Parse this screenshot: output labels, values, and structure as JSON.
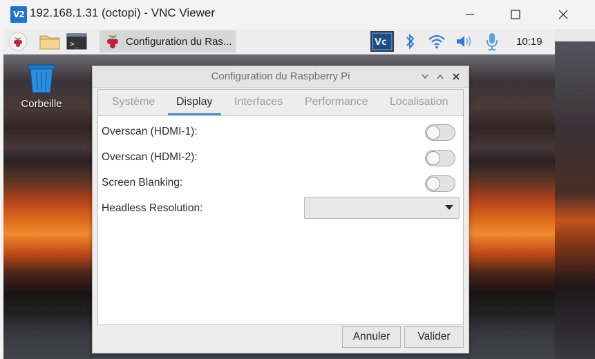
{
  "viewer": {
    "title": "192.168.1.31 (octopi) - VNC Viewer",
    "logo_text": "V2"
  },
  "taskbar": {
    "task_label": "Configuration du Ras...",
    "clock": "10:19"
  },
  "desktop": {
    "trash_label": "Corbeille"
  },
  "dialog": {
    "title": "Configuration du Raspberry Pi",
    "tabs": [
      {
        "label": "Système",
        "active": false
      },
      {
        "label": "Display",
        "active": true
      },
      {
        "label": "Interfaces",
        "active": false
      },
      {
        "label": "Performance",
        "active": false
      },
      {
        "label": "Localisation",
        "active": false
      }
    ],
    "settings": {
      "overscan_hdmi1": {
        "label": "Overscan (HDMI-1):",
        "enabled": false
      },
      "overscan_hdmi2": {
        "label": "Overscan (HDMI-2):",
        "enabled": false
      },
      "screen_blanking": {
        "label": "Screen Blanking:",
        "enabled": false
      },
      "headless_resolution": {
        "label": "Headless Resolution:",
        "value": ""
      }
    },
    "buttons": {
      "cancel": "Annuler",
      "ok": "Valider"
    }
  }
}
